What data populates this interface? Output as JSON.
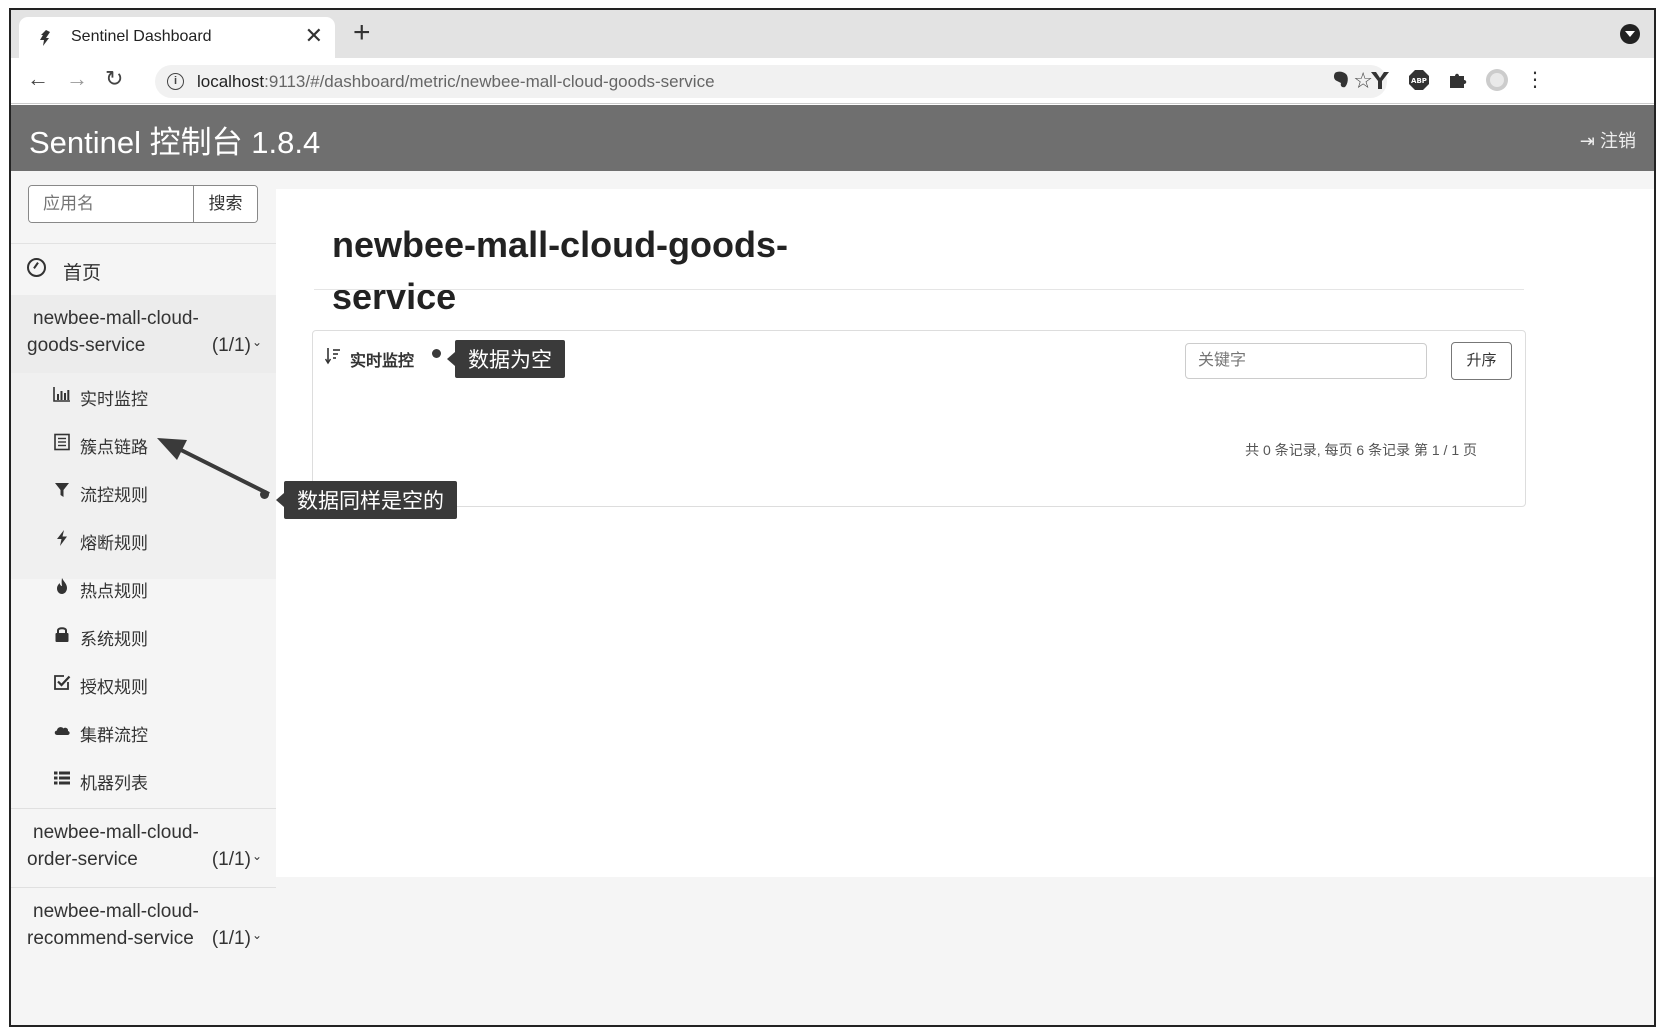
{
  "browser": {
    "tab_title": "Sentinel Dashboard",
    "tab_close": "✕",
    "new_tab": "+",
    "url_host": "localhost",
    "url_rest": ":9113/#/dashboard/metric/newbee-mall-cloud-goods-service",
    "nav": {
      "back": "←",
      "forward": "→",
      "reload": "↻"
    },
    "star": "☆",
    "extensions": [
      "evernote-icon",
      "y-icon",
      "abp-icon",
      "puzzle-icon",
      "profile-icon",
      "menu-icon"
    ]
  },
  "header": {
    "brand": "Sentinel 控制台 1.8.4",
    "logout_label": "注销"
  },
  "sidebar": {
    "search_placeholder": "应用名",
    "search_button": "搜索",
    "home_label": "首页",
    "apps": [
      {
        "name_line1": "newbee-mall-cloud-",
        "name_line2": "goods-service",
        "count": "(1/1)",
        "expanded": true,
        "menu": [
          {
            "icon": "bar-chart-icon",
            "label": "实时监控"
          },
          {
            "icon": "list-icon",
            "label": "簇点链路"
          },
          {
            "icon": "filter-icon",
            "label": "流控规则"
          },
          {
            "icon": "bolt-icon",
            "label": "熔断规则"
          },
          {
            "icon": "fire-icon",
            "label": "热点规则"
          },
          {
            "icon": "lock-icon",
            "label": "系统规则"
          },
          {
            "icon": "check-square-icon",
            "label": "授权规则"
          },
          {
            "icon": "cloud-icon",
            "label": "集群流控"
          },
          {
            "icon": "list-bullets-icon",
            "label": "机器列表"
          }
        ]
      },
      {
        "name_line1": "newbee-mall-cloud-",
        "name_line2": "order-service",
        "count": "(1/1)"
      },
      {
        "name_line1": "newbee-mall-cloud-",
        "name_line2": "recommend-service",
        "count": "(1/1)"
      }
    ]
  },
  "main": {
    "title_line1": "newbee-mall-cloud-goods-",
    "title_line2": "service",
    "panel": {
      "title": "实时监控",
      "keyword_placeholder": "关键字",
      "sort_button": "升序",
      "pager": "共 0 条记录, 每页 6 条记录 第 1 / 1 页"
    }
  },
  "annotations": {
    "empty_data": "数据为空",
    "same_empty": "数据同样是空的"
  },
  "colors": {
    "header_bg": "#6f6f6f",
    "sidebar_bg": "#f5f5f5",
    "callout_bg": "#3a3a3a"
  }
}
